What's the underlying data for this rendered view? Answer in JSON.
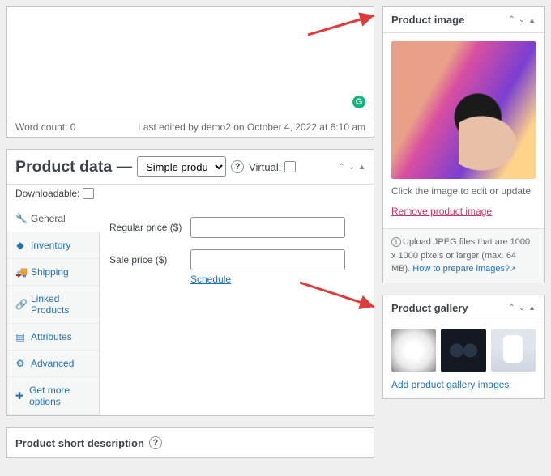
{
  "editor": {
    "word_count_label": "Word count: 0",
    "last_edited": "Last edited by demo2 on October 4, 2022 at 6:10 am"
  },
  "product_data": {
    "title": "Product data",
    "dash": " — ",
    "type_value": "Simple product",
    "virtual_label": "Virtual:",
    "downloadable_label": "Downloadable:",
    "tabs": {
      "general": "General",
      "inventory": "Inventory",
      "shipping": "Shipping",
      "linked": "Linked Products",
      "attributes": "Attributes",
      "advanced": "Advanced",
      "getmore": "Get more options"
    },
    "fields": {
      "regular_price": "Regular price ($)",
      "sale_price": "Sale price ($)",
      "schedule": "Schedule"
    }
  },
  "short_desc": {
    "title": "Product short description"
  },
  "product_image": {
    "title": "Product image",
    "hint": "Click the image to edit or update",
    "remove": "Remove product image",
    "info_pre": "Upload JPEG files that are 1000 x 1000 pixels or larger (max. 64 MB). ",
    "info_link": "How to prepare images?"
  },
  "product_gallery": {
    "title": "Product gallery",
    "add": "Add product gallery images"
  }
}
